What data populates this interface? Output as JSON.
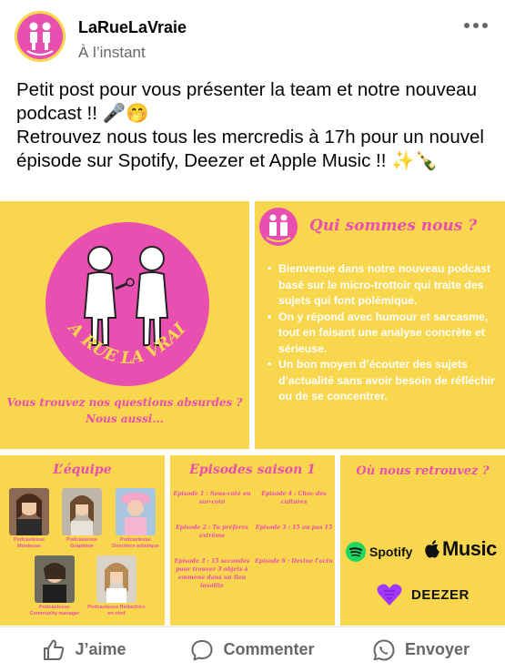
{
  "header": {
    "page_name": "LaRueLaVraie",
    "timestamp": "À l’instant",
    "avatar_icon": "larue-logo-icon",
    "more_icon": "more-dots-icon"
  },
  "post": {
    "line1": "Petit post pour vous présenter la team et notre nouveau podcast !! 🎤🤭",
    "line2": "Retrouvez nous tous les mercredis à 17h pour un nouvel épisode sur Spotify, Deezer et Apple Music !! ✨🍾"
  },
  "grid": {
    "intro": {
      "logo_text": "LA RUE LA VRAIE",
      "tagline_1": "Vous trouvez nos questions absurdes ?",
      "tagline_2": "Nous aussi..."
    },
    "about": {
      "logo_text": "LA RUE LA VRAIE",
      "title": "Qui sommes nous ?",
      "bullets": [
        "Bienvenue dans notre nouveau podcast basé sur le micro-trottoir qui traite des sujets qui font polémique.",
        "On y répond avec humour et sarcasme, tout en faisant  une analyse concrète et sérieuse.",
        "Un bon moyen d’écouter des sujets d’actualité sans avoir besoin de réfléchir ou de se concentrer."
      ]
    },
    "team": {
      "title": "L’équipe",
      "members": [
        {
          "caption": "Podcasteuse Monteuse"
        },
        {
          "caption": "Podcasteuse Graphiste"
        },
        {
          "caption": "Podcasteuse Directrice artistique"
        },
        {
          "caption": "Podcasteuse Community manager"
        },
        {
          "caption": "Podcasteuse Rédactrice en chef"
        }
      ]
    },
    "episodes": {
      "title": "Episodes saison 1",
      "items": [
        "Episode 1 : Sous-coté ou sur-coté",
        "Episode 4 : Choc des cultures",
        "Episode 2 : Tu préfères extrême",
        "Episode 3 : 15 ou pas 15",
        "Episode 3 : 15 secondes pour trouver 3 objets à emmené dans un lieu insolite",
        "Episode 6 : Devine l’actu"
      ]
    },
    "platforms": {
      "title": "Où nous retrouvez ?",
      "spotify": "Spotify",
      "apple": "Music",
      "deezer": "DEEZER"
    }
  },
  "actions": {
    "like": "J’aime",
    "comment": "Commenter",
    "share": "Envoyer"
  },
  "colors": {
    "panel_yellow": "#f8d64e",
    "brand_pink": "#e84fb0",
    "spotify_green": "#1ed760",
    "deezer_purple": "#a238ff"
  }
}
